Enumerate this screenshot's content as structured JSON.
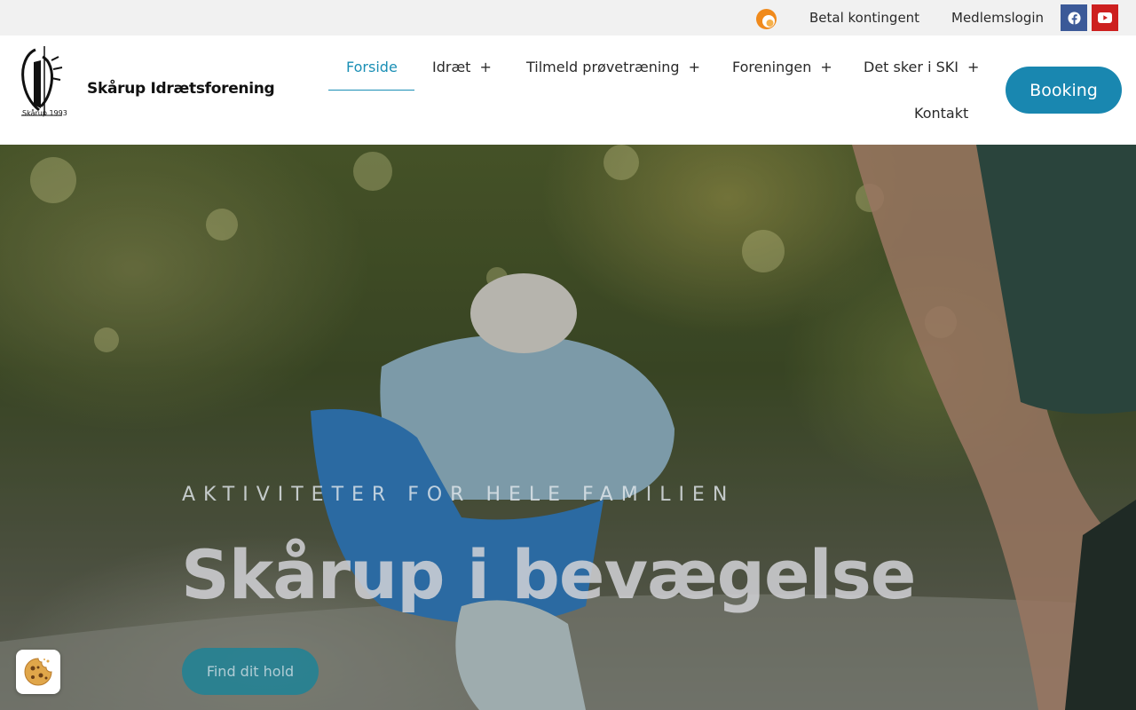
{
  "topbar": {
    "pay_link": "Betal kontingent",
    "login_link": "Medlemslogin",
    "social": [
      "facebook-icon",
      "youtube-icon"
    ],
    "colors": {
      "facebook": "#3b5998",
      "youtube": "#cd201f"
    }
  },
  "header": {
    "logo_text": "Skårup Idrætsforening",
    "logo_year": "Skårup 1993",
    "nav": [
      {
        "label": "Forside",
        "active": true,
        "has_submenu": false
      },
      {
        "label": "Idræt",
        "has_submenu": true
      },
      {
        "label": "Tilmeld prøvetræning",
        "has_submenu": true
      },
      {
        "label": "Foreningen",
        "has_submenu": true
      },
      {
        "label": "Det sker i SKI",
        "has_submenu": true
      },
      {
        "label": "Kontakt",
        "has_submenu": false
      }
    ],
    "submenu_marker": "+",
    "booking_label": "Booking",
    "accent_color": "#1987b0"
  },
  "hero": {
    "kicker": "AKTIVITETER FOR HELE FAMILIEN",
    "title": "Skårup i bevægelse",
    "cta_label": "Find dit hold"
  },
  "cookie_button": {
    "icon": "cookie-icon"
  }
}
